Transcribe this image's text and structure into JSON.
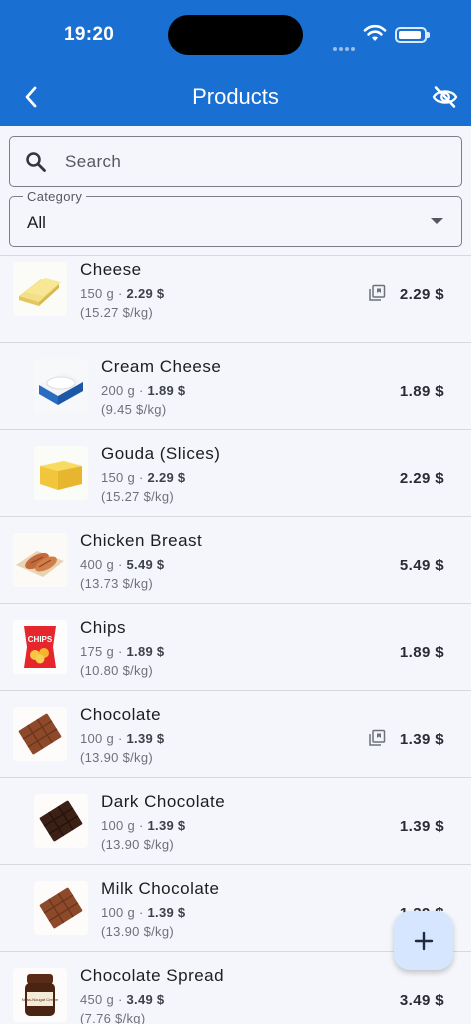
{
  "status_bar": {
    "time": "19:20",
    "battery_level": 0.9
  },
  "app_bar": {
    "title": "Products",
    "back_icon": "chevron-left-icon",
    "action_icon": "eye-off-icon"
  },
  "search": {
    "placeholder": "Search",
    "value": ""
  },
  "category": {
    "label": "Category",
    "value": "All"
  },
  "products": [
    {
      "name": "Cheese",
      "qty": "150 g",
      "sep": " · ",
      "price": "2.29 $",
      "per": "(15.27 $/kg)",
      "price_right": "2.29 $",
      "has_variants": true,
      "child": false,
      "image": "cheese-slices"
    },
    {
      "name": "Cream Cheese",
      "qty": "200 g",
      "sep": " · ",
      "price": "1.89 $",
      "per": "(9.45 $/kg)",
      "price_right": "1.89 $",
      "has_variants": false,
      "child": true,
      "image": "cream-cheese-tub"
    },
    {
      "name": "Gouda (Slices)",
      "qty": "150 g",
      "sep": " · ",
      "price": "2.29 $",
      "per": "(15.27 $/kg)",
      "price_right": "2.29 $",
      "has_variants": false,
      "child": true,
      "image": "gouda-block"
    },
    {
      "name": "Chicken Breast",
      "qty": "400 g",
      "sep": " · ",
      "price": "5.49 $",
      "per": "(13.73 $/kg)",
      "price_right": "5.49 $",
      "has_variants": false,
      "child": false,
      "image": "chicken-breast"
    },
    {
      "name": "Chips",
      "qty": "175 g",
      "sep": " · ",
      "price": "1.89 $",
      "per": "(10.80 $/kg)",
      "price_right": "1.89 $",
      "has_variants": false,
      "child": false,
      "image": "chips-bag",
      "image_text": "CHIPS"
    },
    {
      "name": "Chocolate",
      "qty": "100 g",
      "sep": " · ",
      "price": "1.39 $",
      "per": "(13.90 $/kg)",
      "price_right": "1.39 $",
      "has_variants": true,
      "child": false,
      "image": "milk-chocolate-bar"
    },
    {
      "name": "Dark Chocolate",
      "qty": "100 g",
      "sep": " · ",
      "price": "1.39 $",
      "per": "(13.90 $/kg)",
      "price_right": "1.39 $",
      "has_variants": false,
      "child": true,
      "image": "dark-chocolate-bar"
    },
    {
      "name": "Milk Chocolate",
      "qty": "100 g",
      "sep": " · ",
      "price": "1.39 $",
      "per": "(13.90 $/kg)",
      "price_right": "1.39 $",
      "has_variants": false,
      "child": true,
      "image": "milk-chocolate-bar"
    },
    {
      "name": "Chocolate Spread",
      "qty": "450 g",
      "sep": " · ",
      "price": "3.49 $",
      "per": "(7.76 $/kg)",
      "price_right": "3.49 $",
      "has_variants": false,
      "child": false,
      "image": "spread-jar",
      "image_text": "Nuss-Nougat Creme"
    }
  ],
  "fab": {
    "icon": "plus-icon"
  },
  "colors": {
    "app_bar": "#1a6fd2",
    "background": "#f5f6fb",
    "fab": "#d6e6ff"
  }
}
